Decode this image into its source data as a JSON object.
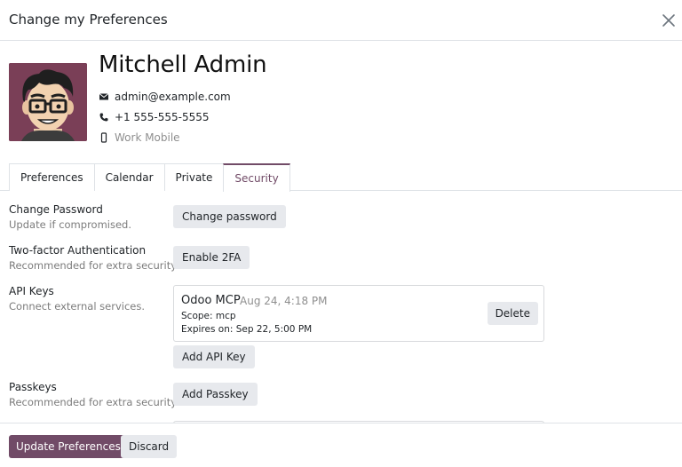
{
  "dialog": {
    "title": "Change my Preferences"
  },
  "profile": {
    "name": "Mitchell Admin",
    "email": "admin@example.com",
    "phone": "+1 555-555-5555",
    "mobile_placeholder": "Work Mobile"
  },
  "tabs": [
    {
      "label": "Preferences",
      "active": false
    },
    {
      "label": "Calendar",
      "active": false
    },
    {
      "label": "Private",
      "active": false
    },
    {
      "label": "Security",
      "active": true
    }
  ],
  "security": {
    "change_password": {
      "label": "Change Password",
      "desc": "Update if compromised.",
      "button": "Change password"
    },
    "two_factor": {
      "label": "Two-factor Authentication",
      "desc": "Recommended for extra security.",
      "button": "Enable 2FA"
    },
    "api_keys": {
      "label": "API Keys",
      "desc": "Connect external services.",
      "keys": [
        {
          "name": "Odoo MCP",
          "date": "Aug 24, 4:18 PM",
          "scope": "Scope: mcp",
          "expires": "Expires on: Sep 22, 5:00 PM",
          "delete_label": "Delete"
        }
      ],
      "add_button": "Add API Key"
    },
    "passkeys": {
      "label": "Passkeys",
      "desc": "Recommended for extra security.",
      "button": "Add Passkey"
    }
  },
  "footer": {
    "primary": "Update Preferences",
    "secondary": "Discard"
  },
  "colors": {
    "accent": "#714b67",
    "button_bg": "#e7e9ed",
    "muted_text": "#7c7c7c"
  },
  "icons": {
    "close": "close-icon",
    "email": "envelope-icon",
    "phone": "phone-icon",
    "mobile": "mobile-icon"
  }
}
